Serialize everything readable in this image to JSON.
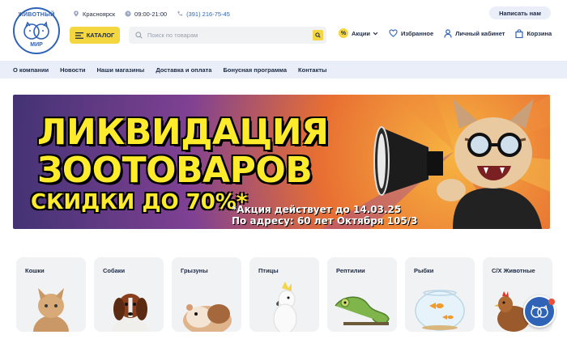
{
  "brand": {
    "logo_top": "ЖИВОТНЫЙ",
    "logo_bottom": "МИР"
  },
  "topbar": {
    "city": "Красноярск",
    "hours": "09:00-21:00",
    "phone": "(391) 216-75-45",
    "write_us": "Написать нам"
  },
  "header": {
    "catalog_label": "КАТАЛОГ",
    "search_placeholder": "Поиск по товарам",
    "promo_label": "Акции",
    "favorites_label": "Избранное",
    "account_label": "Личный кабинет",
    "cart_label": "Корзина"
  },
  "nav": {
    "items": [
      "О компании",
      "Новости",
      "Наши магазины",
      "Доставка и оплата",
      "Бонусная программа",
      "Контакты"
    ]
  },
  "banner": {
    "line1": "ЛИКВИДАЦИЯ",
    "line2": "ЗООТОВАРОВ",
    "line3": "СКИДКИ ДО 70%*",
    "note1": "*Акция действует до 14.03.25",
    "note2": "По адресу: 60 лет Октября 105/3"
  },
  "categories": [
    "Кошки",
    "Собаки",
    "Грызуны",
    "Птицы",
    "Рептилии",
    "Рыбки",
    "С/Х Животные"
  ],
  "colors": {
    "accent": "#f4d740",
    "brand_blue": "#2e63b8",
    "nav_bg": "#e9eef8"
  }
}
